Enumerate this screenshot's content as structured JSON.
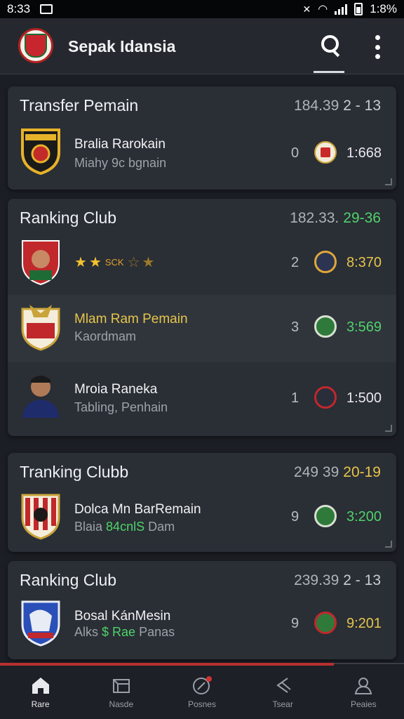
{
  "status": {
    "time": "8:33",
    "battery": "1:8%"
  },
  "app": {
    "title": "Sepak Idansia",
    "search_icon": "search-icon",
    "menu_icon": "more-vert-icon"
  },
  "colors": {
    "accent_green": "#4fd26a",
    "accent_yellow": "#e6c54a",
    "background": "#1b1e24",
    "card": "#2a2e35"
  },
  "cards": [
    {
      "title": "Transfer Pemain",
      "meta": "184.39",
      "meta_hl": "2 - 13",
      "rows": [
        {
          "name": "Bralia Rarokain",
          "sub": "Miahy 9c bgnain",
          "rank": "0",
          "score": "1:668"
        }
      ]
    },
    {
      "title": "Ranking Club",
      "meta": "182.33.",
      "meta_hl": "29-36",
      "rows": [
        {
          "stars_label": "SCK",
          "rank": "2",
          "score": "8:370"
        },
        {
          "name": "Mlam Ram Pemain",
          "sub": "Kaordmam",
          "rank": "3",
          "score": "3:569"
        },
        {
          "name": "Mroia Raneka",
          "sub": "Tabling, Penhain",
          "rank": "1",
          "score": "1:500"
        }
      ]
    },
    {
      "title": "Tranking Clubb",
      "meta": "249 39",
      "meta_hl": "20-19",
      "rows": [
        {
          "name": "Dolca  Mn BarRemain",
          "sub": "Blaia",
          "sub_hl": "84cnlS",
          "sub_tail": "Dam",
          "rank": "9",
          "score": "3:200"
        }
      ]
    },
    {
      "title": "Ranking Club",
      "meta": "239.39",
      "meta_hl": "2 - 13",
      "rows": [
        {
          "name": "Bosal KánMesin",
          "sub": "Alks",
          "sub_hl": "$ Rae",
          "sub_tail": "Panas",
          "rank": "9",
          "score": "9:201"
        }
      ]
    }
  ],
  "nav": [
    {
      "label": "Rare",
      "icon": "home-icon"
    },
    {
      "label": "Nasde",
      "icon": "box-icon"
    },
    {
      "label": "Posnes",
      "icon": "notification-icon"
    },
    {
      "label": "Tsear",
      "icon": "share-icon"
    },
    {
      "label": "Peaies",
      "icon": "profile-icon"
    }
  ]
}
